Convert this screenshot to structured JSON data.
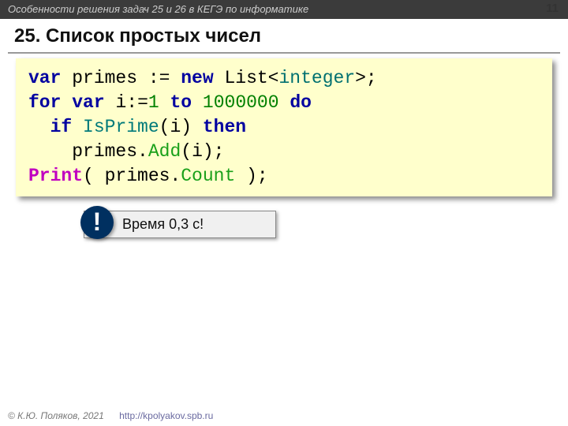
{
  "header": {
    "subtitle": "Особенности решения задач 25 и 26 в КЕГЭ по информатике",
    "page": "11"
  },
  "title": "25. Список простых чисел",
  "code": {
    "l1": {
      "a": "var",
      "b": " primes := ",
      "c": "new",
      "d": " List<",
      "e": "integer",
      "f": ">;"
    },
    "l2": {
      "a": "for",
      "b": " ",
      "c": "var",
      "d": " i:=",
      "e": "1",
      "f": " ",
      "g": "to",
      "h": " ",
      "i": "1000000",
      "j": " ",
      "k": "do"
    },
    "l3": {
      "pad": "  ",
      "a": "if",
      "b": " ",
      "c": "IsPrime",
      "d": "(i) ",
      "e": "then"
    },
    "l4": {
      "pad": "    ",
      "a": "primes.",
      "b": "Add",
      "c": "(i);"
    },
    "l5": {
      "a": "Print",
      "b": "( primes.",
      "c": "Count",
      "d": " );"
    }
  },
  "callout": {
    "badge": "!",
    "text": "Время 0,3 с!"
  },
  "footer": {
    "copy": "© К.Ю. Поляков, 2021",
    "url": "http://kpolyakov.spb.ru"
  }
}
